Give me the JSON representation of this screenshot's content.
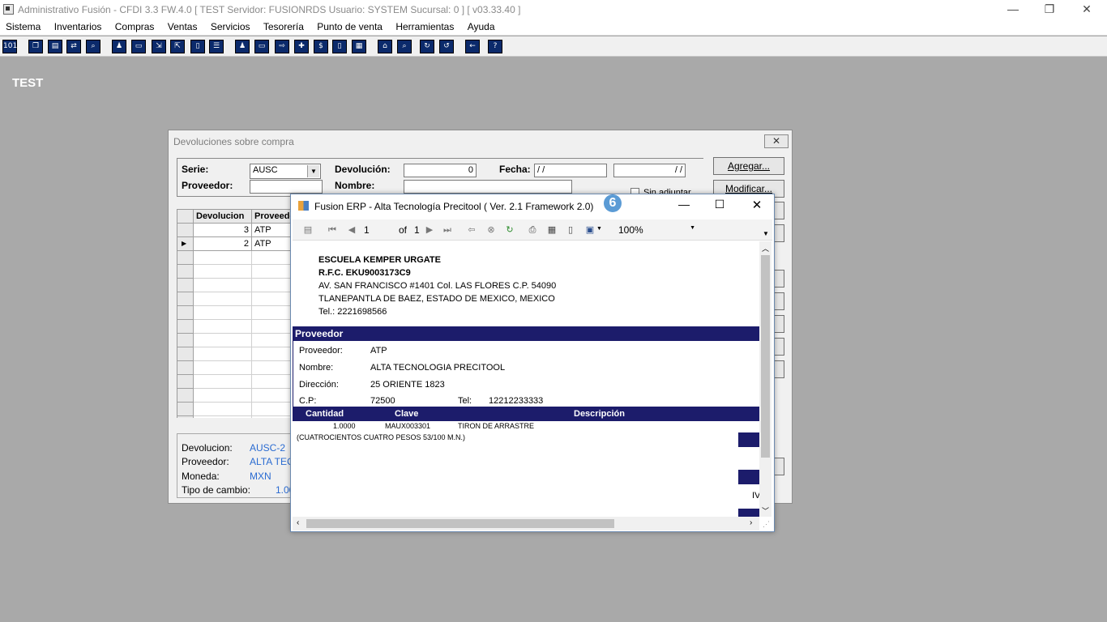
{
  "window": {
    "title": "Administrativo Fusión - CFDI 3.3 FW.4.0 [ TEST  Servidor: FUSIONRDS   Usuario: SYSTEM   Sucursal: 0 ] [ v03.33.40 ]",
    "app_icon": "app-icon",
    "minimize": "—",
    "maximize": "❐",
    "close": "✕"
  },
  "menu": [
    "Sistema",
    "Inventarios",
    "Compras",
    "Ventas",
    "Servicios",
    "Tesorería",
    "Punto de venta",
    "Herramientas",
    "Ayuda"
  ],
  "toolbar_icons": [
    "calculator-icon",
    "copy-icon",
    "clipboard-icon",
    "swap-icon",
    "search-icon",
    "person-icon",
    "folder-icon",
    "import-icon",
    "export-icon",
    "document-icon",
    "list-icon",
    "people-icon",
    "box-icon",
    "send-icon",
    "add-icon",
    "dollar-icon",
    "doc2-icon",
    "grid-icon",
    "home-icon",
    "find-icon",
    "refresh-icon",
    "undo-icon",
    "back-icon",
    "help-icon"
  ],
  "workspace_label": "TEST",
  "dialog": {
    "title": "Devoluciones sobre compra",
    "close": "✕",
    "serie_label": "Serie:",
    "serie_value": "AUSC",
    "devolucion_label": "Devolución:",
    "devolucion_value": "0",
    "fecha_label": "Fecha:",
    "fecha_value1": " / /",
    "fecha_value2": " / /",
    "proveedor_label": "Proveedor:",
    "nombre_label": "Nombre:",
    "sin_adjuntar": "Sin adjuntar",
    "agregar": "Agregar...",
    "modificar": "Modificar...",
    "grid": {
      "headers": [
        "Devolucion",
        "Proveedor"
      ],
      "rows": [
        {
          "num": "3",
          "prov": "ATP"
        },
        {
          "num": "2",
          "prov": "ATP"
        }
      ]
    },
    "info": {
      "devolucion_label": "Devolucion:",
      "devolucion_value": "AUSC-2",
      "proveedor_label": "Proveedor:",
      "proveedor_value": "ALTA TECN",
      "moneda_label": "Moneda:",
      "moneda_value": "MXN",
      "tipo_label": "Tipo de cambio:",
      "tipo_value": "1.00"
    }
  },
  "report": {
    "title": "Fusion ERP - Alta Tecnología Precitool   ( Ver. 2.1 Framework 2.0)",
    "badge": "6",
    "page": "1",
    "of_label": "of",
    "total": "1",
    "zoom": "100%",
    "company": {
      "name": "ESCUELA KEMPER URGATE",
      "rfc": "R.F.C. EKU9003173C9",
      "addr1": "AV. SAN FRANCISCO #1401 Col. LAS FLORES C.P. 54090",
      "addr2": "TLANEPANTLA DE BAEZ, ESTADO DE MEXICO, MEXICO",
      "tel": "Tel.: 2221698566"
    },
    "section": "Proveedor",
    "prov": {
      "proveedor_label": "Proveedor:",
      "proveedor_value": "ATP",
      "nombre_label": "Nombre:",
      "nombre_value": "ALTA TECNOLOGIA PRECITOOL",
      "direccion_label": "Dirección:",
      "direccion_value": "25 ORIENTE 1823",
      "cp_label": "C.P:",
      "cp_value": "72500",
      "tel_label": "Tel:",
      "tel_value": "12212233333"
    },
    "items_headers": [
      "Cantidad",
      "Clave",
      "Descripción"
    ],
    "item": {
      "cantidad": "1.0000",
      "clave": "MAUX003301",
      "descripcion": "TIRON DE ARRASTRE"
    },
    "amount_words": "(CUATROCIENTOS CUATRO PESOS 53/100 M.N.)",
    "side_text": "IV"
  }
}
